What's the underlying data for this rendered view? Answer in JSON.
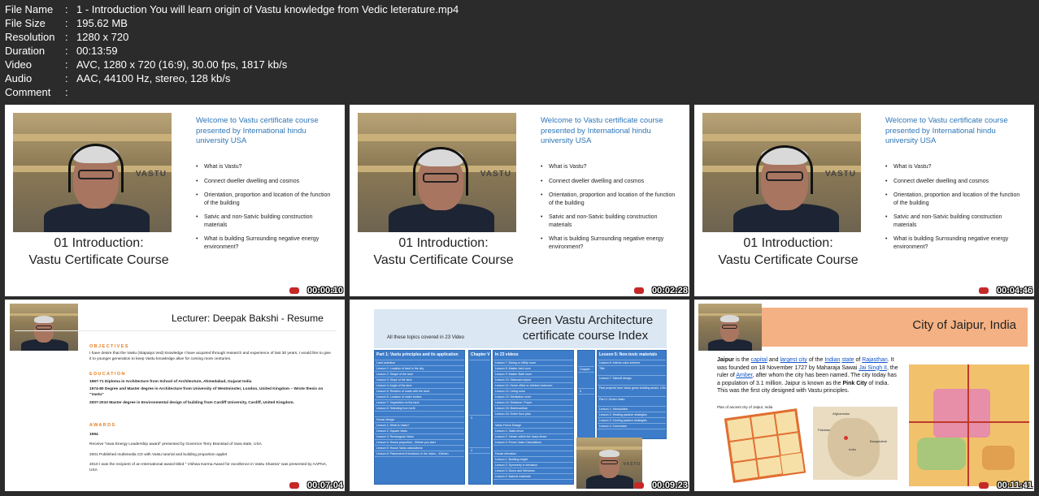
{
  "file_info": {
    "rows": [
      {
        "key": "File Name",
        "sep": ":",
        "value": "1 - Introduction You will learn origin of Vastu knowledge from Vedic leterature.mp4"
      },
      {
        "key": "File Size",
        "sep": ":",
        "value": "195.62 MB"
      },
      {
        "key": "Resolution",
        "sep": ":",
        "value": "1280 x 720"
      },
      {
        "key": "Duration",
        "sep": ":",
        "value": "00:13:59"
      },
      {
        "key": "Video",
        "sep": ":",
        "value": "AVC, 1280 x 720 (16:9), 30.00 fps, 1817 kb/s"
      },
      {
        "key": "Audio",
        "sep": ":",
        "value": "AAC, 44100 Hz, stereo, 128 kb/s"
      },
      {
        "key": "Comment",
        "sep": ":",
        "value": ""
      }
    ]
  },
  "intro_slide": {
    "welcome": "Welcome to Vastu certificate course presented  by International hindu university USA",
    "bullets": [
      "What is Vastu?",
      "Connect dweller dwelling and cosmos",
      "Orientation, proportion and location of the function of the building",
      "Satvic and non-Satvic building construction materials",
      "What is building Surrounding negative energy environment?"
    ],
    "title_line1": "01 Introduction:",
    "title_line2": "Vastu Certificate Course",
    "cam_sign": "VASTU"
  },
  "thumbnails": [
    {
      "timestamp": "00:00:10"
    },
    {
      "timestamp": "00:02:28"
    },
    {
      "timestamp": "00:04:46"
    },
    {
      "timestamp": "00:07:04"
    },
    {
      "timestamp": "00:09:23"
    },
    {
      "timestamp": "00:11:41"
    }
  ],
  "resume_slide": {
    "title": "Lecturer:  Deepak Bakshi - Resume",
    "objectives_head": "OBJECTIVES",
    "objectives_text": "I have desire that the Vastu (Stapatya Ved) knowledge I have acquired through research and experience of last 30 years, I would like to give it to younger generation to keep Vastu knowledge alive for coming more centuries.",
    "education_head": "EDUCATION",
    "education": [
      "1967-71  Diploma in Architecture from School of Architecture, Ahmedabad, Gujarat  India",
      "1974-80  Degree and Master degree in Architecture from University of Westminster, London, United Kingdom – Wrote thesis on “Vastu”",
      "2007-2010  Master degree in Environmental design of building from Cardiff University, Cardiff, United Kingdom."
    ],
    "awards_head": "AWARDS",
    "awards": [
      "1994",
      "Receive “Iowa Energy Leadership award” presented by Governor Terry Branstad of Iowa state, USA",
      "2001  Published  multimedia CD with Vastu tutorial and building proportion applet",
      "2010  I was the recipient of an International award titled “ Vishwa Karma Award for excellence in Vastu Shastra” was presented by AAPNA, USA"
    ]
  },
  "index_slide": {
    "title_line1": "Green Vastu Architecture",
    "title_line2": "certificate course  Index",
    "subtitle": "All these topics covered in 23 Video",
    "col1_head": "Part 1: Vastu principles and its application",
    "col1_rows": [
      "Land selection",
      "Lesson 1: Location of land in the city",
      "Lesson 2: Shape of the land",
      "Lesson 3: Slope of the land",
      "Lesson 4: Angle of the land",
      "Lesson 5: Relation of roads with the land",
      "Lesson 6: Location of water bodies",
      "Lesson 7: Vegetation on the land",
      "Lesson 8: Selecting true north",
      "",
      "House design",
      "Lesson 1: What is Vastu?",
      "Lesson 2: Square Vastu",
      "Lesson 3: Rectangular Vastu",
      "Lesson 4: House proportion - Before you start",
      "Lesson 5: House Vastu calculations",
      "Lesson 6: Placement of functions in the Vastu – Kitchen"
    ],
    "col2_head": "Chapter V",
    "col3_head": "In 23 videos",
    "col3_rows": [
      "Lesson 7: Dining or Utility room",
      "Lesson 8: Master bed room",
      "Lesson 9: Master Bath room",
      "Lesson 10: Staircase layout",
      "Lesson 11: Home office or children bedroom",
      "Lesson 12: Living room",
      "Lesson 13: Meditation room",
      "Lesson 14: Entrance / Foyer",
      "Lesson 15: Brahmasthan",
      "Lesson 16: Entire floor plan",
      "",
      "Vastu Fence Design",
      "Lesson 1: Vastu fence",
      "Lesson 2: Viewer within the Vastu fence",
      "Lesson 3: Fence Vastu Calculations",
      "",
      "House elevation",
      "Lesson 1: Building height",
      "Lesson 2: Symmetry in elevation",
      "Lesson 3: Doors and Windows",
      "Lesson 4: Natural materials"
    ],
    "col4_head": "Lesson 5: Non-toxic materials",
    "col4_rows": [
      "Lesson 6: Interior color scheme",
      "Title",
      "Lesson 7: Takeoff design",
      "Past projects from Vastu green building studio, USA",
      "Part 2: Green  Vastu",
      "Lesson 1: Introduction",
      "Lesson 2: Heating passive strategies",
      "Lesson 3: Cooling passive strategies",
      "Lesson 4: Conclusion"
    ],
    "chapter_marks": [
      "3",
      "4",
      "Chapter",
      "5"
    ],
    "cam_sign": "VASTU"
  },
  "jaipur_slide": {
    "title": "City of Jaipur, India",
    "text_parts": [
      {
        "t": "Jaipur",
        "style": "bold"
      },
      {
        "t": " is the ",
        "style": ""
      },
      {
        "t": "capital",
        "style": "link"
      },
      {
        "t": " and ",
        "style": ""
      },
      {
        "t": "largest city",
        "style": "link"
      },
      {
        "t": " of the ",
        "style": ""
      },
      {
        "t": "Indian",
        "style": "link"
      },
      {
        "t": " ",
        "style": ""
      },
      {
        "t": "state",
        "style": "link"
      },
      {
        "t": " of ",
        "style": ""
      },
      {
        "t": "Rajasthan",
        "style": "link"
      },
      {
        "t": ". It was founded on 18 November 1727 by Maharaja Sawai ",
        "style": ""
      },
      {
        "t": "Jai Singh II",
        "style": "link"
      },
      {
        "t": ", the ruler of ",
        "style": ""
      },
      {
        "t": "Amber",
        "style": "link"
      },
      {
        "t": ", after whom the city has been named. The city today has a population of 3.1 million. Jaipur is known as the ",
        "style": ""
      },
      {
        "t": "Pink City",
        "style": "bold"
      },
      {
        "t": " of India. This was the first city designed with Vastu principles.",
        "style": ""
      }
    ],
    "caption": "Plan of ancient city of Jaipur, India",
    "map_labels": [
      "Afghanistan",
      "Pakistan",
      "Bangladesh",
      "India"
    ]
  },
  "colors": {
    "background": "#2b2b2b",
    "accent_blue": "#2e75b6",
    "table_blue": "#3d7cc9",
    "banner_orange": "#f4b183"
  }
}
